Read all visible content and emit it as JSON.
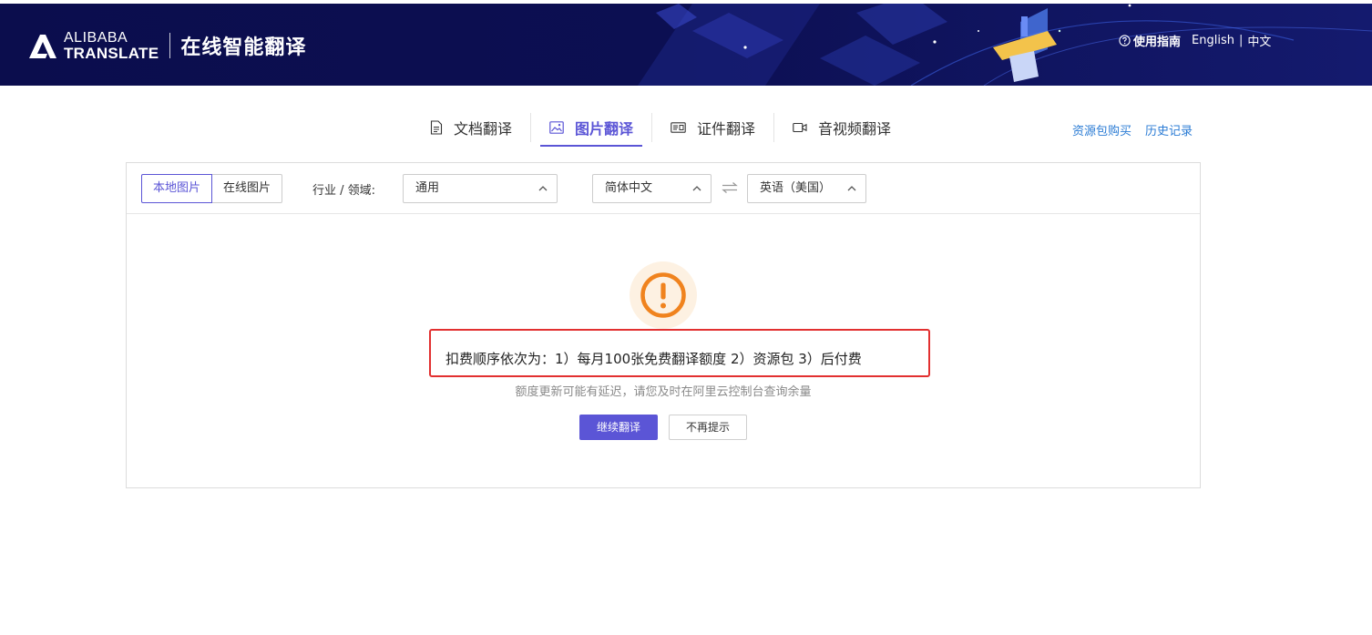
{
  "header": {
    "logo_line1": "ALIBABA",
    "logo_line2": "TRANSLATE",
    "title": "在线智能翻译",
    "help_label": "使用指南",
    "lang_english": "English",
    "lang_separator": "|",
    "lang_chinese": "中文",
    "bg_color": "#0c0f52"
  },
  "tabs": [
    {
      "label": "文档翻译",
      "icon": "document-icon",
      "active": false
    },
    {
      "label": "图片翻译",
      "icon": "image-icon",
      "active": true
    },
    {
      "label": "证件翻译",
      "icon": "id-card-icon",
      "active": false
    },
    {
      "label": "音视频翻译",
      "icon": "video-icon",
      "active": false
    }
  ],
  "side_links": {
    "buy": "资源包购买",
    "history": "历史记录"
  },
  "toolbar": {
    "local_image": "本地图片",
    "online_image": "在线图片",
    "industry_label": "行业 / 领域:",
    "industry_value": "通用",
    "source_lang": "简体中文",
    "target_lang": "英语（美国）"
  },
  "notice": {
    "message": "扣费顺序依次为：1）每月100张免费翻译额度 2）资源包 3）后付费",
    "sub_message": "额度更新可能有延迟，请您及时在阿里云控制台查询余量",
    "continue_button": "继续翻译",
    "dismiss_button": "不再提示"
  },
  "colors": {
    "accent": "#5b55d6",
    "link": "#2a7bd4",
    "warning": "#f0831e",
    "highlight_border": "#e23030"
  }
}
